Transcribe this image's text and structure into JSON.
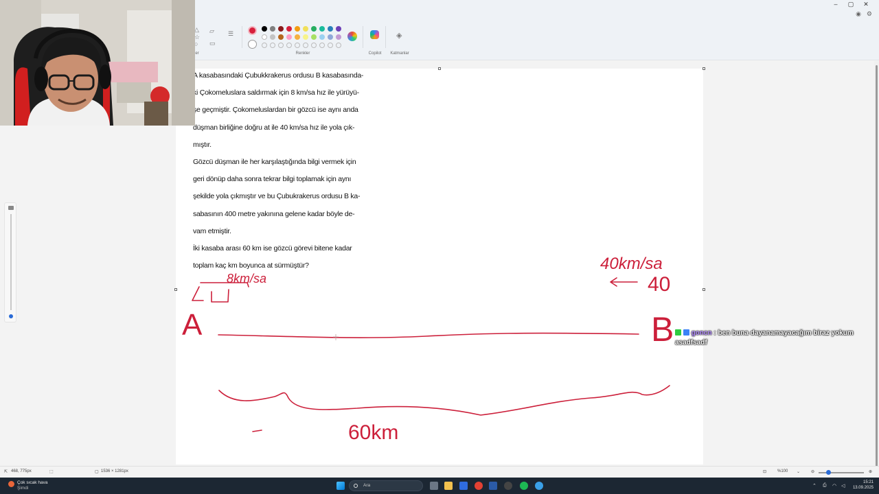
{
  "ribbon": {
    "colors_label": "Renkler",
    "copilot_label": "Copilot",
    "layers_label": "Katmanlar",
    "shapes_label_partial": "ler",
    "accent": "#d71f3c",
    "palette_row1": [
      "#000000",
      "#7f7f7f",
      "#8b1a1a",
      "#d71f3c",
      "#f39c12",
      "#f1e05a",
      "#27ae60",
      "#1abc9c",
      "#2980b9",
      "#6c3fb6"
    ],
    "palette_row2": [
      "#ffffff",
      "#c3c3c3",
      "#b5651d",
      "#ff9ec4",
      "#f5b041",
      "#f7f48b",
      "#a8e063",
      "#9ad1f0",
      "#8fa8d8",
      "#c39bd3"
    ]
  },
  "window_controls": [
    "–",
    "▢",
    "✕"
  ],
  "problem_text": [
    "A kasabasındaki Çubukkrakerus ordusu B kasabasında-",
    "ki Çokomeluslara saldırmak için 8 km/sa hız ile yürüyü-",
    "şe geçmiştir. Çokomeluslardan bir gözcü ise aynı anda",
    "düşman birliğine doğru at ile 40 km/sa hız ile yola çık-",
    "mıştır.",
    "Gözcü düşman ile her karşılaştığında bilgi vermek için",
    "geri dönüp daha sonra tekrar bilgi toplamak için aynı",
    "şekilde yola çıkmıştır ve bu Çubukrakerus ordusu B ka-",
    "sabasının 400 metre yakınına gelene kadar böyle de-",
    "vam etmiştir.",
    "İki kasaba arası 60 km ise gözcü görevi bitene kadar",
    "toplam kaç km boyunca at sürmüştür?"
  ],
  "annotations": {
    "left_speed": "8km/sa",
    "left_value": "4",
    "right_speed": "40km/sa",
    "right_value": "40",
    "point_a": "A",
    "point_b": "B",
    "distance": "60km"
  },
  "chat": {
    "username": "goncn",
    "message": "ben buna dayanamayacağım biraz yokum asadfsadf",
    "badge_colors": [
      "#2ecc40",
      "#3b82f6"
    ]
  },
  "statusbar": {
    "cursor_pos": "468, 775px",
    "canvas_size": "1536 × 1281px",
    "zoom": "%100"
  },
  "taskbar": {
    "weather_title": "Çok sıcak hava",
    "weather_sub": "Şimdi",
    "search_placeholder": "Ara",
    "time": "15:21",
    "date": "13.09.2025"
  }
}
